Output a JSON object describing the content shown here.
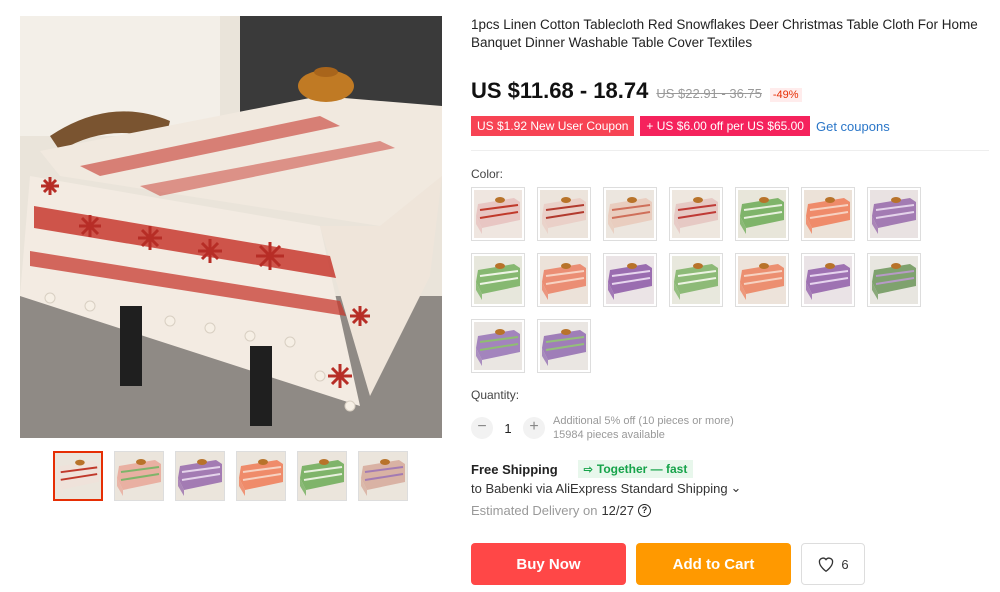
{
  "product": {
    "title": "1pcs Linen Cotton Tablecloth Red Snowflakes Deer Christmas Table Cloth For Home Banquet Dinner Washable Table Cover Textiles",
    "price": "US $11.68 - 18.74",
    "original_price": "US $22.91 - 36.75",
    "discount": "-49%"
  },
  "coupons": {
    "new_user": "US $1.92 New User Coupon",
    "store": "+ US $6.00 off per US $65.00",
    "get_coupons": "Get coupons"
  },
  "color": {
    "label": "Color:",
    "swatches": [
      {
        "name": "red-snowflake",
        "bg": "#efe6e0",
        "cloth": "#e8c6c3",
        "accent": "#c0392b"
      },
      {
        "name": "red-snowflake-2",
        "bg": "#ece4dc",
        "cloth": "#ead0c8",
        "accent": "#b23a2e"
      },
      {
        "name": "red-plaid",
        "bg": "#ece6df",
        "cloth": "#e9cdbf",
        "accent": "#cf6f5a"
      },
      {
        "name": "red-deer",
        "bg": "#eee7df",
        "cloth": "#e6c9c4",
        "accent": "#bf3a36"
      },
      {
        "name": "green-stripe",
        "bg": "#e8e6da",
        "cloth": "#7fb46a",
        "accent": "#e8f0de"
      },
      {
        "name": "salmon-stripe",
        "bg": "#ece2d8",
        "cloth": "#ef8b6a",
        "accent": "#f6d2c2"
      },
      {
        "name": "purple-floral",
        "bg": "#e9e2e2",
        "cloth": "#a37bb3",
        "accent": "#e4d3ea"
      },
      {
        "name": "green-plaid",
        "bg": "#e7e7dc",
        "cloth": "#86b871",
        "accent": "#eef4e6"
      },
      {
        "name": "salmon-plaid",
        "bg": "#ece2d9",
        "cloth": "#eb8e74",
        "accent": "#f7d3c3"
      },
      {
        "name": "purple-snow",
        "bg": "#ebe4e6",
        "cloth": "#9a6db0",
        "accent": "#e7d6ee"
      },
      {
        "name": "green-check",
        "bg": "#e8e8dd",
        "cloth": "#8dba77",
        "accent": "#edf3e3"
      },
      {
        "name": "coral-check",
        "bg": "#ede3da",
        "cloth": "#ec8f70",
        "accent": "#f6d3c2"
      },
      {
        "name": "purple-pattern",
        "bg": "#eae3e6",
        "cloth": "#9e72b2",
        "accent": "#e6d4ee"
      },
      {
        "name": "green-purple",
        "bg": "#e8e6e0",
        "cloth": "#7fa26e",
        "accent": "#b79ac7"
      },
      {
        "name": "green-violet",
        "bg": "#eae6e2",
        "cloth": "#a384bd",
        "accent": "#8fbd72"
      },
      {
        "name": "violet-green",
        "bg": "#eae6e2",
        "cloth": "#9f7eb8",
        "accent": "#94bf7a"
      }
    ]
  },
  "thumbnails": [
    {
      "name": "red-snowflake",
      "cloth": "#efe2da",
      "accent": "#c0392b",
      "active": true
    },
    {
      "name": "mixed",
      "cloth": "#e9b0a2",
      "accent": "#7fb46a",
      "active": false
    },
    {
      "name": "purple",
      "cloth": "#a37bb3",
      "accent": "#e4d3ea",
      "active": false
    },
    {
      "name": "salmon",
      "cloth": "#ef8b6a",
      "accent": "#f6d2c2",
      "active": false
    },
    {
      "name": "green",
      "cloth": "#7fb46a",
      "accent": "#e8f0de",
      "active": false
    },
    {
      "name": "mixed-2",
      "cloth": "#d9b2a4",
      "accent": "#a37bb3",
      "active": false
    }
  ],
  "quantity": {
    "label": "Quantity:",
    "value": "1",
    "minus": "−",
    "plus": "+",
    "note": "Additional 5% off (10 pieces or more)",
    "available": "15984 pieces available"
  },
  "shipping": {
    "title": "Free Shipping",
    "together": "Together — fast",
    "route": "to Babenki via AliExpress Standard Shipping",
    "estimated_label": "Estimated Delivery on",
    "estimated_date": "12/27"
  },
  "actions": {
    "buy_now": "Buy Now",
    "add_to_cart": "Add to Cart",
    "wish_count": "6"
  },
  "colors": {
    "primary_red": "#ff4747",
    "cart_orange": "#ff9900",
    "link_blue": "#2a76c8"
  }
}
